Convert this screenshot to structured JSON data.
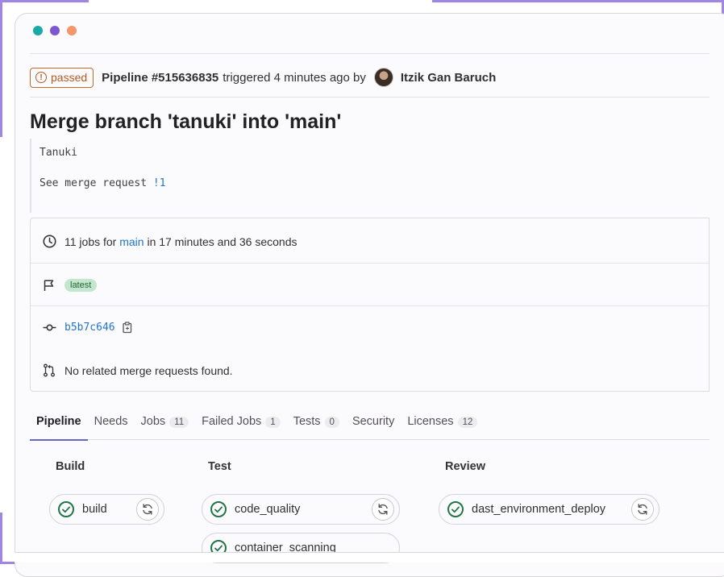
{
  "window": {
    "dots": [
      "#1aaaa5",
      "#7b58cf",
      "#f5966b"
    ]
  },
  "header": {
    "status": "passed",
    "pipeline": "Pipeline #515636835",
    "triggered": "triggered 4 minutes ago by",
    "author": "Itzik Gan Baruch"
  },
  "commit": {
    "title": "Merge branch 'tanuki' into 'main'",
    "desc_line1": "Tanuki",
    "desc_line2_prefix": "See merge request ",
    "desc_line2_link": "!1"
  },
  "info": {
    "jobs_prefix": "11 jobs for ",
    "branch": "main",
    "jobs_suffix": " in 17 minutes and 36 seconds",
    "tag": "latest",
    "sha": "b5b7c646",
    "merge_requests": "No related merge requests found."
  },
  "tabs": [
    {
      "label": "Pipeline",
      "count": ""
    },
    {
      "label": "Needs",
      "count": ""
    },
    {
      "label": "Jobs",
      "count": "11"
    },
    {
      "label": "Failed Jobs",
      "count": "1"
    },
    {
      "label": "Tests",
      "count": "0"
    },
    {
      "label": "Security",
      "count": ""
    },
    {
      "label": "Licenses",
      "count": "12"
    }
  ],
  "stages": {
    "build": {
      "title": "Build",
      "jobs": [
        "build"
      ]
    },
    "test": {
      "title": "Test",
      "jobs": [
        "code_quality",
        "container_scanning"
      ]
    },
    "review": {
      "title": "Review",
      "jobs": [
        "dast_environment_deploy"
      ]
    }
  },
  "colors": {
    "success": "#217645",
    "link": "#1f75cb",
    "warning": "#c66a2c",
    "accent": "#9f86e4"
  }
}
